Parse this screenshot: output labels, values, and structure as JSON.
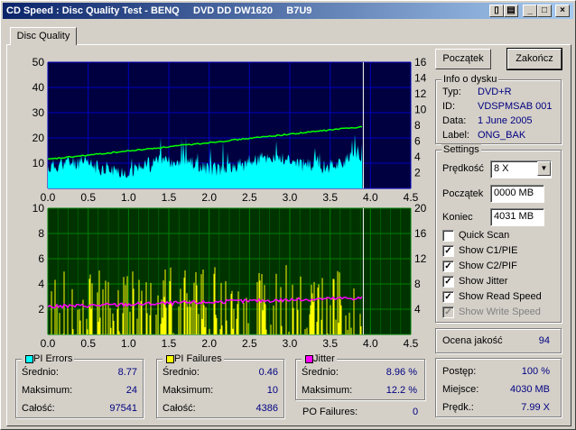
{
  "window": {
    "title": "CD Speed : Disc Quality Test - BENQ     DVD DD DW1620     B7U9"
  },
  "tab": {
    "label": "Disc Quality"
  },
  "buttons": {
    "start": "Początek",
    "end": "Zakończ"
  },
  "info": {
    "title": "Info o dysku",
    "type_label": "Typ:",
    "type_value": "DVD+R",
    "id_label": "ID:",
    "id_value": "VDSPMSAB 001",
    "date_label": "Data:",
    "date_value": "1 June 2005",
    "label_label": "Label:",
    "label_value": "ONG_BAK"
  },
  "settings": {
    "title": "Settings",
    "speed_label": "Prędkość",
    "speed_value": "8 X",
    "start_label": "Początek",
    "start_value": "0000 MB",
    "end_label": "Koniec",
    "end_value": "4031 MB",
    "checks": [
      {
        "label": "Quick Scan",
        "checked": false,
        "disabled": false
      },
      {
        "label": "Show C1/PIE",
        "checked": true,
        "disabled": false
      },
      {
        "label": "Show C2/PIF",
        "checked": true,
        "disabled": false
      },
      {
        "label": "Show Jitter",
        "checked": true,
        "disabled": false
      },
      {
        "label": "Show Read Speed",
        "checked": true,
        "disabled": false
      },
      {
        "label": "Show Write Speed",
        "checked": true,
        "disabled": true
      }
    ]
  },
  "quality": {
    "label": "Ocena jakość",
    "value": "94"
  },
  "progress": {
    "progress_label": "Postęp:",
    "progress_value": "100 %",
    "place_label": "Miejsce:",
    "place_value": "4030 MB",
    "speed_label": "Prędk.:",
    "speed_value": "7.99 X"
  },
  "pi_errors": {
    "title": "PI Errors",
    "avg_label": "Średnio:",
    "avg": "8.77",
    "max_label": "Maksimum:",
    "max": "24",
    "total_label": "Całość:",
    "total": "97541"
  },
  "pi_failures": {
    "title": "PI Failures",
    "avg_label": "Średnio:",
    "avg": "0.46",
    "max_label": "Maksimum:",
    "max": "10",
    "total_label": "Całość:",
    "total": "4386"
  },
  "jitter": {
    "title": "Jitter",
    "avg_label": "Średnio:",
    "avg": "8.96 %",
    "max_label": "Maksimum:",
    "max": "12.2 %"
  },
  "po_failures": {
    "label": "PO Failures:",
    "value": "0"
  },
  "colors": {
    "pie": "#00ffff",
    "pif": "#ffff00",
    "jitter": "#ff00ff",
    "speed": "#00ff00",
    "top_bg": "#000040",
    "bottom_bg": "#003300"
  },
  "chart_data": [
    {
      "type": "area",
      "series": [
        {
          "name": "PI Errors",
          "avg": 8.77,
          "max": 24
        }
      ],
      "x_ticks": [
        "0.0",
        "0.5",
        "1.0",
        "1.5",
        "2.0",
        "2.5",
        "3.0",
        "3.5",
        "4.0",
        "4.5"
      ],
      "y_left_ticks": [
        "50",
        "40",
        "30",
        "20",
        "10"
      ],
      "y_right_ticks": [
        "16",
        "14",
        "12",
        "10",
        "8",
        "6",
        "4",
        "2"
      ],
      "xlim": [
        0,
        4.5
      ],
      "ylim": [
        0,
        50
      ],
      "y2lim": [
        0,
        16
      ],
      "read_speed": {
        "x": [
          0,
          3.9
        ],
        "y": [
          4.0,
          7.99
        ]
      }
    },
    {
      "type": "bar",
      "series": [
        {
          "name": "PI Failures",
          "avg": 0.46,
          "max": 10
        },
        {
          "name": "Jitter",
          "avg": 8.96
        }
      ],
      "x_ticks": [
        "0.0",
        "0.5",
        "1.0",
        "1.5",
        "2.0",
        "2.5",
        "3.0",
        "3.5",
        "4.0",
        "4.5"
      ],
      "y_left_ticks": [
        "10",
        "8",
        "6",
        "4",
        "2"
      ],
      "y_right_ticks": [
        "20",
        "16",
        "12",
        "8",
        "4"
      ],
      "xlim": [
        0,
        4.5
      ],
      "ylim": [
        0,
        10
      ],
      "y2lim": [
        0,
        20
      ]
    }
  ]
}
